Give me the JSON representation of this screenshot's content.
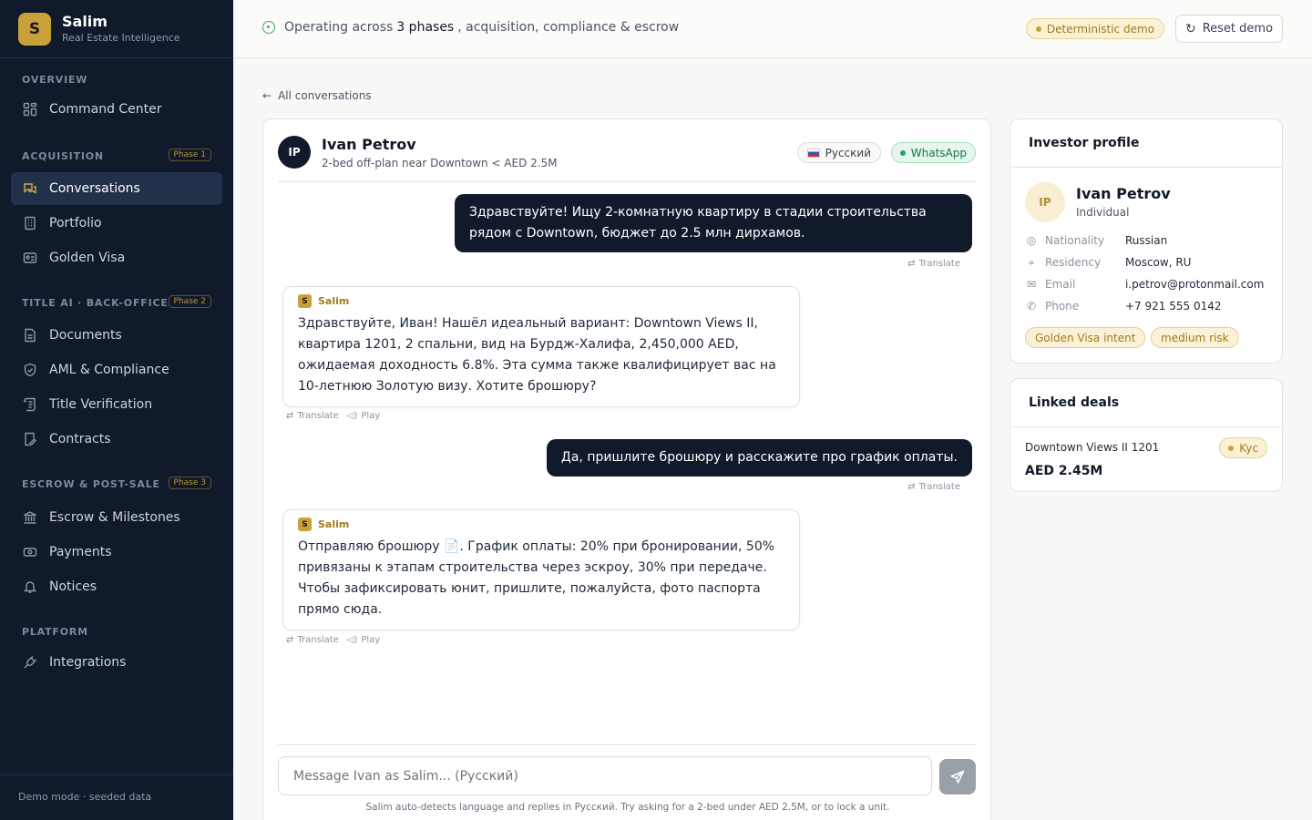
{
  "brand": {
    "logo_letter": "S",
    "name": "Salim",
    "subtitle": "Real Estate Intelligence"
  },
  "sidebar": {
    "sections": [
      {
        "label": "OVERVIEW",
        "phase": ""
      },
      {
        "label": "ACQUISITION",
        "phase": "Phase 1"
      },
      {
        "label": "TITLE AI · BACK-OFFICE",
        "phase": "Phase 2"
      },
      {
        "label": "ESCROW & POST-SALE",
        "phase": "Phase 3"
      },
      {
        "label": "PLATFORM",
        "phase": ""
      }
    ],
    "items": [
      {
        "label": "Command Center",
        "icon": "grid-icon"
      },
      {
        "label": "Conversations",
        "icon": "chat-icon",
        "active": true
      },
      {
        "label": "Portfolio",
        "icon": "building-icon"
      },
      {
        "label": "Golden Visa",
        "icon": "id-card-icon"
      },
      {
        "label": "Documents",
        "icon": "document-icon"
      },
      {
        "label": "AML & Compliance",
        "icon": "shield-icon"
      },
      {
        "label": "Title Verification",
        "icon": "scroll-icon"
      },
      {
        "label": "Contracts",
        "icon": "contract-icon"
      },
      {
        "label": "Escrow & Milestones",
        "icon": "bank-icon"
      },
      {
        "label": "Payments",
        "icon": "banknote-icon"
      },
      {
        "label": "Notices",
        "icon": "bell-icon"
      },
      {
        "label": "Integrations",
        "icon": "plug-icon"
      }
    ],
    "footer": "Demo mode · seeded data"
  },
  "topbar": {
    "status_prefix": "Operating across",
    "status_strong": "3 phases",
    "status_suffix": ", acquisition, compliance & escrow",
    "demo_badge": "Deterministic demo",
    "reset_label": "Reset demo"
  },
  "back_link": "All conversations",
  "chat": {
    "initials": "IP",
    "name": "Ivan Petrov",
    "subtitle": "2-bed off-plan near Downtown < AED 2.5M",
    "language": "Русский",
    "channel": "WhatsApp",
    "messages": [
      {
        "direction": "out",
        "text": "Здравствуйте! Ищу 2-комнатную квартиру в стадии строительства рядом с Downtown, бюджет до 2.5 млн дирхамов.",
        "actions": [
          "Translate"
        ]
      },
      {
        "direction": "in",
        "sender": "Salim",
        "text": "Здравствуйте, Иван! Нашёл идеальный вариант: Downtown Views II, квартира 1201, 2 спальни, вид на Бурдж-Халифа, 2,450,000 AED, ожидаемая доходность 6.8%. Эта сумма также квалифицирует вас на 10-летнюю Золотую визу. Хотите брошюру?",
        "actions": [
          "Translate",
          "Play"
        ]
      },
      {
        "direction": "out",
        "text": "Да, пришлите брошюру и расскажите про график оплаты.",
        "actions": [
          "Translate"
        ]
      },
      {
        "direction": "in",
        "sender": "Salim",
        "text": "Отправляю брошюру 📄. График оплаты: 20% при бронировании, 50% привязаны к этапам строительства через эскроу, 30% при передаче. Чтобы зафиксировать юнит, пришлите, пожалуйста, фото паспорта прямо сюда.",
        "actions": [
          "Translate",
          "Play"
        ]
      }
    ],
    "composer_placeholder": "Message Ivan as Salim... (Русский)",
    "hint": "Salim auto-detects language and replies in Русский. Try asking for a 2-bed under AED 2.5M, or to lock a unit."
  },
  "profile": {
    "title": "Investor profile",
    "initials": "IP",
    "name": "Ivan Petrov",
    "type": "Individual",
    "fields": [
      {
        "label": "Nationality",
        "value": "Russian",
        "icon": "globe-icon"
      },
      {
        "label": "Residency",
        "value": "Moscow, RU",
        "icon": "pin-icon"
      },
      {
        "label": "Email",
        "value": "i.petrov@protonmail.com",
        "icon": "mail-icon"
      },
      {
        "label": "Phone",
        "value": "+7 921 555 0142",
        "icon": "phone-icon"
      }
    ],
    "tags": [
      "Golden Visa intent",
      "medium risk"
    ]
  },
  "deals": {
    "title": "Linked deals",
    "items": [
      {
        "name": "Downtown Views II 1201",
        "amount": "AED 2.45M",
        "stage": "Kyc"
      }
    ]
  },
  "colors": {
    "sidebar_bg": "#111a2b",
    "accent_gold": "#c9a13b",
    "whatsapp_green": "#17753f"
  }
}
